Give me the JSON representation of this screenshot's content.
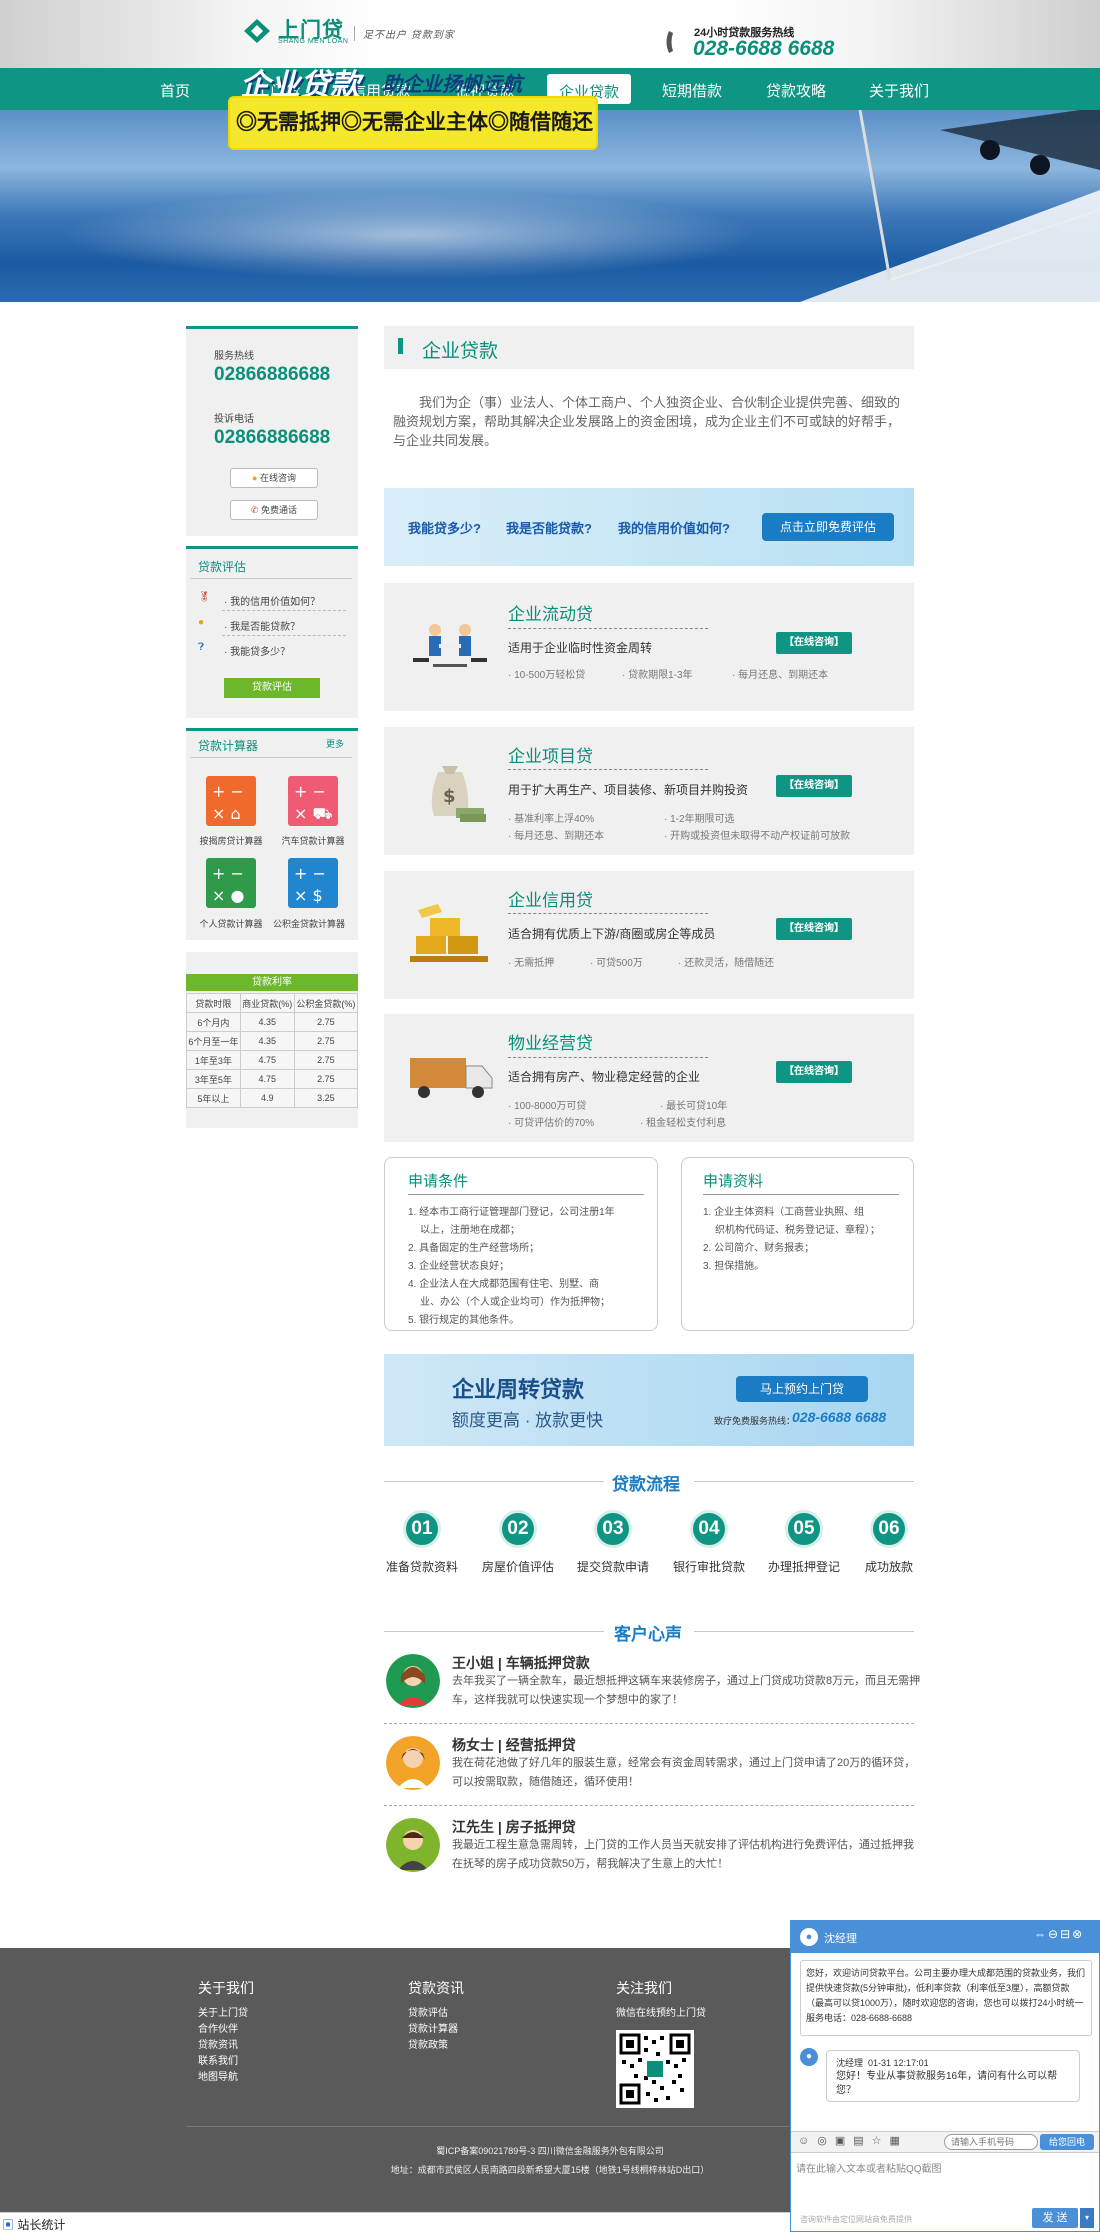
{
  "header": {
    "logo_cn": "上门贷",
    "logo_en": "SHANG MEN LOAN",
    "slogan": "足不出户  贷款到家",
    "hotline_label": "24小时贷款服务热线",
    "hotline_number": "028-6688 6688"
  },
  "nav": {
    "items": [
      "首页",
      "上门贷",
      "信用贷款",
      "抵押贷款",
      "企业贷款",
      "短期借款",
      "贷款攻略",
      "关于我们"
    ],
    "active": "企业贷款"
  },
  "banner": {
    "title": "企业贷款",
    "subtitle": "助企业扬帆远航",
    "highlights": "◎无需抵押◎无需企业主体◎随借随还"
  },
  "sidebar": {
    "service_label": "服务热线",
    "service_number": "02866886688",
    "complaint_label": "投诉电话",
    "complaint_number": "02866886688",
    "online_btn": "在线咨询",
    "call_btn": "免费通话",
    "eval_title": "贷款评估",
    "eval_items": [
      "· 我的信用价值如何？",
      "· 我是否能贷款？",
      "· 我能贷多少？"
    ],
    "eval_btn": "贷款评估",
    "calc_title": "贷款计算器",
    "calc_more": "更多",
    "calcs": [
      "按揭房贷计算器",
      "汽车贷款计算器",
      "个人贷款计算器",
      "公积金贷款计算器"
    ],
    "rate_title": "贷款利率",
    "rate_headers": [
      "贷款时限",
      "商业贷款(%)",
      "公积金贷款(%)"
    ],
    "rate_rows": [
      [
        "6个月内",
        "4.35",
        "2.75"
      ],
      [
        "6个月至一年",
        "4.35",
        "2.75"
      ],
      [
        "1年至3年",
        "4.75",
        "2.75"
      ],
      [
        "3年至5年",
        "4.75",
        "2.75"
      ],
      [
        "5年以上",
        "4.9",
        "3.25"
      ]
    ]
  },
  "main": {
    "section_title": "企业贷款",
    "intro": "我们为企（事）业法人、个体工商户、个人独资企业、合伙制企业提供完善、细致的融资规划方案，帮助其解决企业发展路上的资金困境，成为企业主们不可或缺的好帮手，与企业共同发展。",
    "ask": [
      "我能贷多少?",
      "我是否能贷款?",
      "我的信用价值如何?"
    ],
    "ask_btn": "点击立即免费评估",
    "consult_label": "【在线咨询】",
    "products": [
      {
        "title": "企业流动贷",
        "desc": "适用于企业临时性资金周转",
        "features": [
          "· 10-500万轻松贷",
          "· 贷款期限1-3年",
          "· 每月还息、到期还本"
        ]
      },
      {
        "title": "企业项目贷",
        "desc": "用于扩大再生产、项目装修、新项目并购投资",
        "features": [
          "· 基准利率上浮40%",
          "· 1-2年期限可选",
          "· 每月还息、到期还本",
          "· 开购或投资但未取得不动产权证前可放款"
        ]
      },
      {
        "title": "企业信用贷",
        "desc": "适合拥有优质上下游/商圈或房企等成员",
        "features": [
          "· 无需抵押",
          "· 可贷500万",
          "· 还款灵活，随借随还"
        ]
      },
      {
        "title": "物业经营贷",
        "desc": "适合拥有房产、物业稳定经营的企业",
        "features": [
          "· 100-8000万可贷",
          "· 最长可贷10年",
          "· 可贷评估价的70%",
          "· 租金轻松支付利息"
        ]
      }
    ],
    "conditions": {
      "title": "申请条件",
      "lines": [
        "1. 经本市工商行证管理部门登记，公司注册1年",
        "   以上，注册地在成都；",
        "2. 具备固定的生产经营场所；",
        "3. 企业经营状态良好；",
        "4. 企业法人在大成都范围有住宅、别墅、商",
        "   业、办公（个人或企业均可）作为抵押物；",
        "5. 银行规定的其他条件。"
      ]
    },
    "materials": {
      "title": "申请资料",
      "lines": [
        "1. 企业主体资料（工商营业执照、组",
        "   织机构代码证、税务登记证、章程）；",
        "2. 公司简介、财务报表；",
        "3. 担保措施。"
      ]
    },
    "promo": {
      "title": "企业周转贷款",
      "sub": "额度更高 · 放款更快",
      "btn": "马上预约上门贷",
      "call_label": "致疗免费服务热线：",
      "call_number": "028-6688 6688"
    },
    "process_title": "贷款流程",
    "process": [
      {
        "n": "01",
        "label": "准备贷款资料"
      },
      {
        "n": "02",
        "label": "房屋价值评估"
      },
      {
        "n": "03",
        "label": "提交贷款申请"
      },
      {
        "n": "04",
        "label": "银行审批贷款"
      },
      {
        "n": "05",
        "label": "办理抵押登记"
      },
      {
        "n": "06",
        "label": "成功放款"
      }
    ],
    "voice_title": "客户心声",
    "voices": [
      {
        "name": "王小姐 | 车辆抵押贷款",
        "text": "去年我买了一辆全款车，最近想抵押这辆车来装修房子，通过上门贷成功贷款8万元，而且无需押车，这样我就可以快速实现一个梦想中的家了！",
        "color": "#1f9a52"
      },
      {
        "name": "杨女士 | 经营抵押贷",
        "text": "我在荷花池做了好几年的服装生意，经常会有资金周转需求，通过上门贷申请了20万的循环贷，可以按需取款，随借随还，循环使用！",
        "color": "#f3a428"
      },
      {
        "name": "江先生 | 房子抵押贷",
        "text": "我最近工程生意急需周转，上门贷的工作人员当天就安排了评估机构进行免费评估，通过抵押我在抚琴的房子成功贷款50万，帮我解决了生意上的大忙！",
        "color": "#7fb52d"
      }
    ]
  },
  "footer": {
    "about_title": "关于我们",
    "about_links": [
      "关于上门贷",
      "合作伙伴",
      "贷款资讯",
      "联系我们",
      "地图导航"
    ],
    "news_title": "贷款资讯",
    "news_links": [
      "贷款评估",
      "贷款计算器",
      "贷款政策"
    ],
    "follow_title": "关注我们",
    "follow_text": "微信在线预约上门贷",
    "icp": "蜀ICP备案09021789号-3   四川微信金融服务外包有限公司",
    "address": "地址：成都市武侯区人民南路四段新希望大厦15楼（地铁1号线桐梓林站D出口）",
    "stats": "站长统计"
  },
  "chat": {
    "agent": "沈经理",
    "greeting": "您好，欢迎访问贷款平台。公司主要办理大成都范围的贷款业务，我们提供快速贷款(5分钟审批)，低利率贷款（利率低至3厘），高额贷款（最高可以贷1000万），随时欢迎您的咨询，您也可以拨打24小时统一服务电话：028-6688-6688",
    "msg_sender": "沈经理",
    "msg_time": "01-31 12:17:01",
    "msg_text": "您好！专业从事贷款服务16年，请问有什么可以帮您？",
    "phone_placeholder": "请输入手机号码",
    "callback_btn": "给您回电",
    "input_placeholder": "请在此输入文本或者粘贴QQ截图",
    "powered": "咨询软件由定位网站商免费提供",
    "send_btn": "发 送",
    "controls": [
      "⇔",
      "⊖",
      "⊟",
      "⊗"
    ]
  }
}
